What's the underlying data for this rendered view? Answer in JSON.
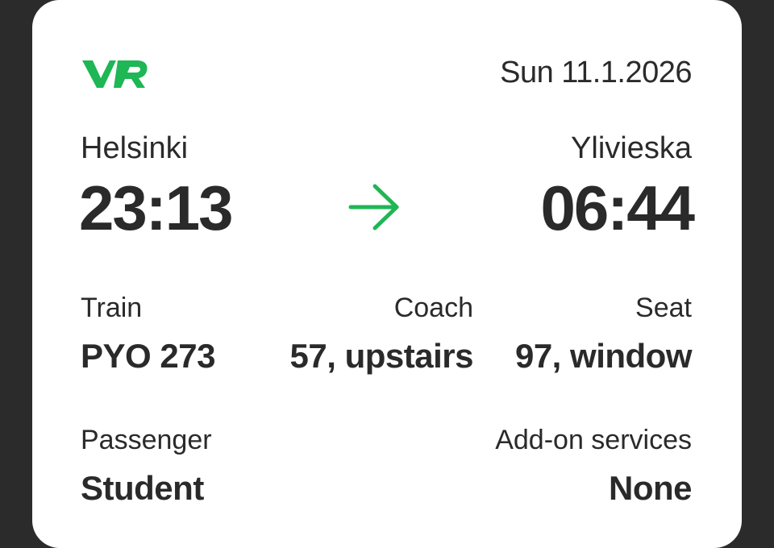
{
  "brand": {
    "logo_text": "VR",
    "accent_color": "#1fb655"
  },
  "date": "Sun 11.1.2026",
  "journey": {
    "from_city": "Helsinki",
    "to_city": "Ylivieska",
    "departure_time": "23:13",
    "arrival_time": "06:44",
    "arrow_icon": "arrow-right-icon"
  },
  "details": {
    "train_label": "Train",
    "train_value": "PYO 273",
    "coach_label": "Coach",
    "coach_value": "57, upstairs",
    "seat_label": "Seat",
    "seat_value": "97, window",
    "passenger_label": "Passenger",
    "passenger_value": "Student",
    "addon_label": "Add-on services",
    "addon_value": "None"
  }
}
